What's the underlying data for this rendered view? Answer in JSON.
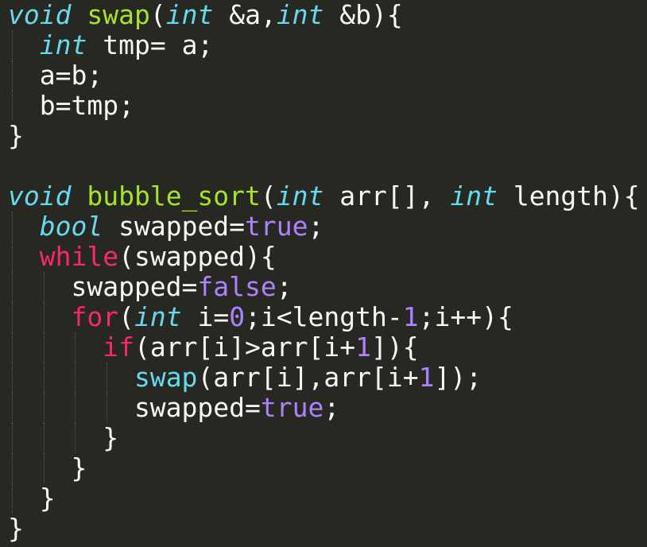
{
  "editor": {
    "colors": {
      "background": "#272822",
      "plain": "#f8f8f2",
      "storage_type": "#66d9ef",
      "function_name": "#a6e22e",
      "keyword": "#f92672",
      "constant": "#ae81ff",
      "indent_guide": "#5a5a52"
    },
    "lines": [
      {
        "indent": 0,
        "tokens": [
          {
            "t": "void",
            "c": "storage_type",
            "i": true
          },
          {
            "t": " ",
            "c": "plain"
          },
          {
            "t": "swap",
            "c": "function_name"
          },
          {
            "t": "(",
            "c": "plain"
          },
          {
            "t": "int",
            "c": "storage_type",
            "i": true
          },
          {
            "t": " &a,",
            "c": "plain"
          },
          {
            "t": "int",
            "c": "storage_type",
            "i": true
          },
          {
            "t": " &b){",
            "c": "plain"
          }
        ]
      },
      {
        "indent": 1,
        "tokens": [
          {
            "t": "  ",
            "c": "plain"
          },
          {
            "t": "int",
            "c": "storage_type",
            "i": true
          },
          {
            "t": " tmp= a;",
            "c": "plain"
          }
        ]
      },
      {
        "indent": 1,
        "tokens": [
          {
            "t": "  a=b;",
            "c": "plain"
          }
        ]
      },
      {
        "indent": 1,
        "tokens": [
          {
            "t": "  b=tmp;",
            "c": "plain"
          }
        ]
      },
      {
        "indent": 0,
        "tokens": [
          {
            "t": "}",
            "c": "plain"
          }
        ]
      },
      {
        "indent": 0,
        "tokens": []
      },
      {
        "indent": 0,
        "tokens": [
          {
            "t": "void",
            "c": "storage_type",
            "i": true
          },
          {
            "t": " ",
            "c": "plain"
          },
          {
            "t": "bubble_sort",
            "c": "function_name"
          },
          {
            "t": "(",
            "c": "plain"
          },
          {
            "t": "int",
            "c": "storage_type",
            "i": true
          },
          {
            "t": " arr[], ",
            "c": "plain"
          },
          {
            "t": "int",
            "c": "storage_type",
            "i": true
          },
          {
            "t": " length){",
            "c": "plain"
          }
        ]
      },
      {
        "indent": 1,
        "tokens": [
          {
            "t": "  ",
            "c": "plain"
          },
          {
            "t": "bool",
            "c": "storage_type",
            "i": true
          },
          {
            "t": " swapped=",
            "c": "plain"
          },
          {
            "t": "true",
            "c": "constant"
          },
          {
            "t": ";",
            "c": "plain"
          }
        ]
      },
      {
        "indent": 1,
        "tokens": [
          {
            "t": "  ",
            "c": "plain"
          },
          {
            "t": "while",
            "c": "keyword"
          },
          {
            "t": "(swapped){",
            "c": "plain"
          }
        ]
      },
      {
        "indent": 2,
        "tokens": [
          {
            "t": "    swapped=",
            "c": "plain"
          },
          {
            "t": "false",
            "c": "constant"
          },
          {
            "t": ";",
            "c": "plain"
          }
        ]
      },
      {
        "indent": 2,
        "tokens": [
          {
            "t": "    ",
            "c": "plain"
          },
          {
            "t": "for",
            "c": "keyword"
          },
          {
            "t": "(",
            "c": "plain"
          },
          {
            "t": "int",
            "c": "storage_type",
            "i": true
          },
          {
            "t": " i=",
            "c": "plain"
          },
          {
            "t": "0",
            "c": "constant"
          },
          {
            "t": ";i<length-",
            "c": "plain"
          },
          {
            "t": "1",
            "c": "constant"
          },
          {
            "t": ";i++){",
            "c": "plain"
          }
        ]
      },
      {
        "indent": 3,
        "tokens": [
          {
            "t": "      ",
            "c": "plain"
          },
          {
            "t": "if",
            "c": "keyword"
          },
          {
            "t": "(arr[i]>arr[i+",
            "c": "plain"
          },
          {
            "t": "1",
            "c": "constant"
          },
          {
            "t": "]){",
            "c": "plain"
          }
        ]
      },
      {
        "indent": 4,
        "tokens": [
          {
            "t": "        ",
            "c": "plain"
          },
          {
            "t": "swap",
            "c": "storage_type"
          },
          {
            "t": "(arr[i],arr[i+",
            "c": "plain"
          },
          {
            "t": "1",
            "c": "constant"
          },
          {
            "t": "]);",
            "c": "plain"
          }
        ]
      },
      {
        "indent": 4,
        "tokens": [
          {
            "t": "        swapped=",
            "c": "plain"
          },
          {
            "t": "true",
            "c": "constant"
          },
          {
            "t": ";",
            "c": "plain"
          }
        ]
      },
      {
        "indent": 3,
        "tokens": [
          {
            "t": "      }",
            "c": "plain"
          }
        ]
      },
      {
        "indent": 2,
        "tokens": [
          {
            "t": "    }",
            "c": "plain"
          }
        ]
      },
      {
        "indent": 1,
        "tokens": [
          {
            "t": "  }",
            "c": "plain"
          }
        ]
      },
      {
        "indent": 0,
        "tokens": [
          {
            "t": "}",
            "c": "plain"
          }
        ]
      }
    ]
  }
}
